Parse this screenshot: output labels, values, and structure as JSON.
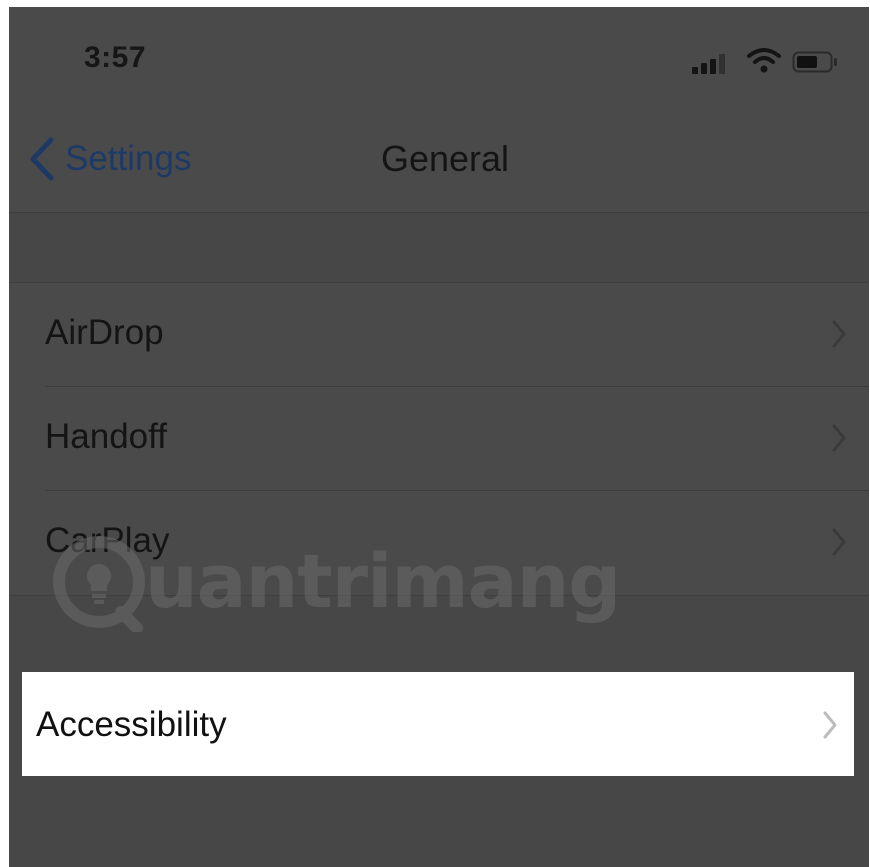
{
  "status_bar": {
    "time": "3:57",
    "icons": [
      "signal-icon",
      "wifi-icon",
      "battery-icon"
    ]
  },
  "nav": {
    "back_label": "Settings",
    "title": "General"
  },
  "settings_rows": [
    {
      "label": "AirDrop"
    },
    {
      "label": "Handoff"
    },
    {
      "label": "CarPlay"
    }
  ],
  "highlighted_row": {
    "label": "Accessibility"
  },
  "watermark": {
    "text": "uantrimang"
  },
  "colors": {
    "overlay_gray": "#474747",
    "back_link": "#1d3a66",
    "highlight_bg": "#ffffff",
    "chevron": "#bcbcbc"
  }
}
